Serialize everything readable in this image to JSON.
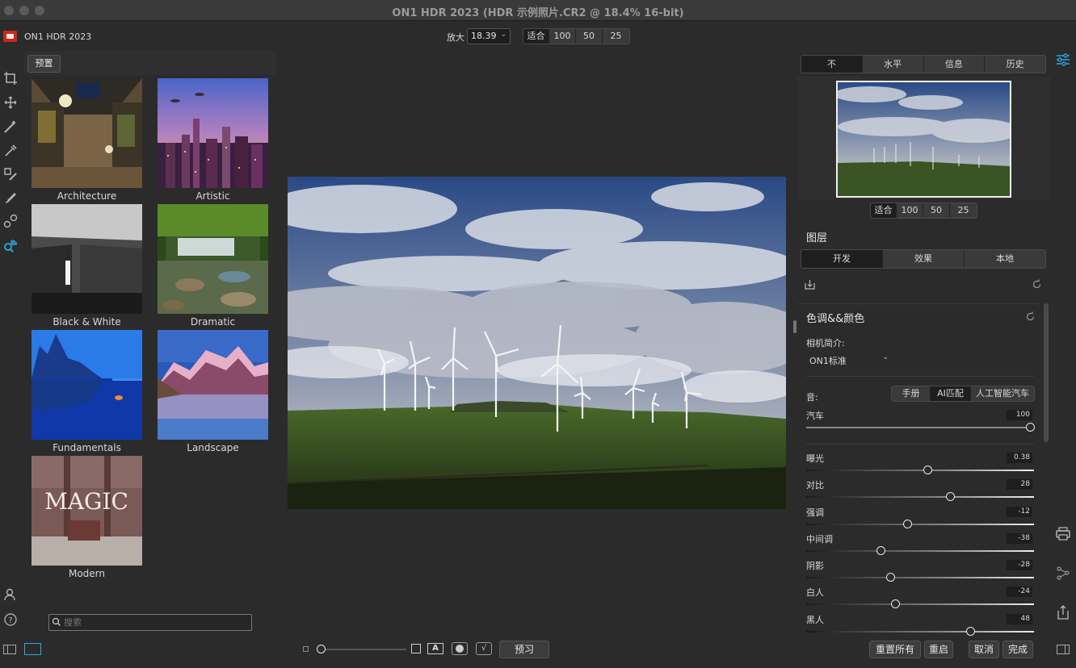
{
  "window": {
    "title": "ON1 HDR 2023 (HDR 示例照片.CR2 @ 18.4% 16-bit)"
  },
  "toolbar": {
    "app_name": "ON1 HDR 2023",
    "zoom_label": "放大",
    "zoom_value": "18.39",
    "view_buttons": [
      "适合",
      "100",
      "50",
      "25"
    ]
  },
  "presets": {
    "header_button": "预置",
    "items": [
      {
        "label": "Architecture"
      },
      {
        "label": "Artistic"
      },
      {
        "label": "Black & White"
      },
      {
        "label": "Dramatic"
      },
      {
        "label": "Fundamentals"
      },
      {
        "label": "Landscape"
      },
      {
        "label": "Modern"
      }
    ],
    "modern_thumb_text": "MAGIC",
    "search_placeholder": "搜索"
  },
  "bottom_bar": {
    "preview_button": "预习",
    "text_toggle": "A",
    "reset_all": "重置所有",
    "restart": "重启",
    "cancel": "取消",
    "done": "完成"
  },
  "right_panel": {
    "top_tabs": [
      "不",
      "水平",
      "信息",
      "历史"
    ],
    "nav_buttons": [
      "适合",
      "100",
      "50",
      "25"
    ],
    "layers_title": "图层",
    "layer_tabs": [
      "开发",
      "效果",
      "本地"
    ],
    "section_title": "色调&&颜色",
    "camera_profile_label": "相机简介:",
    "camera_profile_value": "ON1标准",
    "tone_label": "音:",
    "tone_modes": [
      "手册",
      "AI匹配",
      "人工智能汽车"
    ],
    "sliders": [
      {
        "label": "汽车",
        "value": "100",
        "pos": 1.0
      },
      {
        "label": "曝光",
        "value": "0.38",
        "pos": 0.532
      },
      {
        "label": "对比",
        "value": "28",
        "pos": 0.636
      },
      {
        "label": "强调",
        "value": "-12",
        "pos": 0.443
      },
      {
        "label": "中间调",
        "value": "-38",
        "pos": 0.32
      },
      {
        "label": "阴影",
        "value": "-28",
        "pos": 0.365
      },
      {
        "label": "白人",
        "value": "-24",
        "pos": 0.387
      },
      {
        "label": "黑人",
        "value": "48",
        "pos": 0.727
      }
    ]
  }
}
